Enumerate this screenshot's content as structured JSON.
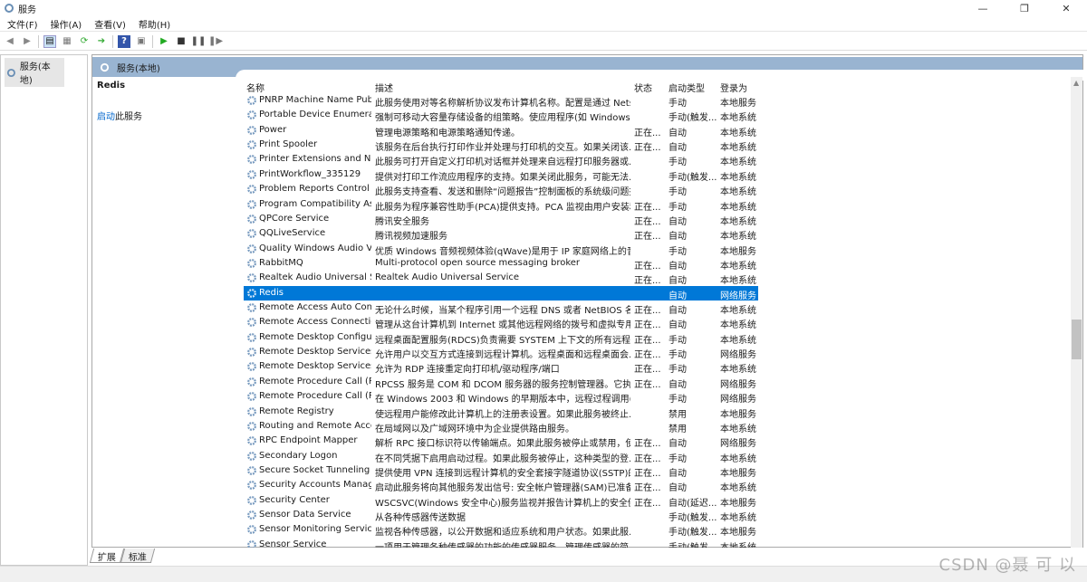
{
  "window": {
    "title": "服务",
    "minimize": "—",
    "maximize": "❐",
    "close": "✕"
  },
  "menu": [
    "文件(F)",
    "操作(A)",
    "查看(V)",
    "帮助(H)"
  ],
  "tree": {
    "root": "服务(本地)"
  },
  "pane": {
    "header": "服务(本地)",
    "selected_service": "Redis",
    "action_link": "启动",
    "action_suffix": "此服务"
  },
  "columns": [
    "名称",
    "描述",
    "状态",
    "启动类型",
    "登录为"
  ],
  "rows": [
    [
      "PNRP Machine Name Publ...",
      "此服务使用对等名称解析协议发布计算机名称。配置是通过 Nets...",
      "",
      "手动",
      "本地服务"
    ],
    [
      "Portable Device Enumerat...",
      "强制可移动大容量存储设备的组策略。使应用程序(如 Windows ...",
      "",
      "手动(触发...",
      "本地系统"
    ],
    [
      "Power",
      "管理电源策略和电源策略通知传递。",
      "正在...",
      "自动",
      "本地系统"
    ],
    [
      "Print Spooler",
      "该服务在后台执行打印作业并处理与打印机的交互。如果关闭该...",
      "正在...",
      "自动",
      "本地系统"
    ],
    [
      "Printer Extensions and Noti...",
      "此服务可打开自定义打印机对话框并处理来自远程打印服务器或...",
      "",
      "手动",
      "本地系统"
    ],
    [
      "PrintWorkflow_335129",
      "提供对打印工作流应用程序的支持。如果关闭此服务，可能无法...",
      "",
      "手动(触发...",
      "本地系统"
    ],
    [
      "Problem Reports Control P...",
      "此服务支持查看、发送和删除“问题报告”控制面板的系统级问题报...",
      "",
      "手动",
      "本地系统"
    ],
    [
      "Program Compatibility Assi...",
      "此服务为程序兼容性助手(PCA)提供支持。PCA 监视由用户安装和...",
      "正在...",
      "手动",
      "本地系统"
    ],
    [
      "QPCore Service",
      "腾讯安全服务",
      "正在...",
      "自动",
      "本地系统"
    ],
    [
      "QQLiveService",
      "腾讯视频加速服务",
      "正在...",
      "自动",
      "本地系统"
    ],
    [
      "Quality Windows Audio Vi...",
      "优质 Windows 音频视频体验(qWave)是用于 IP 家庭网络上的音...",
      "",
      "手动",
      "本地服务"
    ],
    [
      "RabbitMQ",
      "Multi-protocol open source messaging broker",
      "正在...",
      "自动",
      "本地系统"
    ],
    [
      "Realtek Audio Universal Se...",
      "Realtek Audio Universal Service",
      "正在...",
      "自动",
      "本地系统"
    ],
    [
      "Redis",
      "",
      "",
      "自动",
      "网络服务"
    ],
    [
      "Remote Access Auto Conn...",
      "无论什么时候，当某个程序引用一个远程 DNS 或者 NetBIOS 名...",
      "正在...",
      "自动",
      "本地系统"
    ],
    [
      "Remote Access Connectio...",
      "管理从这台计算机到 Internet 或其他远程网络的拨号和虚拟专用...",
      "正在...",
      "自动",
      "本地系统"
    ],
    [
      "Remote Desktop Configur...",
      "远程桌面配置服务(RDCS)负责需要 SYSTEM 上下文的所有远程桌...",
      "正在...",
      "手动",
      "本地系统"
    ],
    [
      "Remote Desktop Services",
      "允许用户以交互方式连接到远程计算机。远程桌面和远程桌面会...",
      "正在...",
      "手动",
      "网络服务"
    ],
    [
      "Remote Desktop Services ...",
      "允许为 RDP 连接重定向打印机/驱动程序/端口",
      "正在...",
      "手动",
      "本地系统"
    ],
    [
      "Remote Procedure Call (R...",
      "RPCSS 服务是 COM 和 DCOM 服务器的服务控制管理器。它执...",
      "正在...",
      "自动",
      "网络服务"
    ],
    [
      "Remote Procedure Call (R...",
      "在 Windows 2003 和 Windows 的早期版本中，远程过程调用(RP...",
      "",
      "手动",
      "网络服务"
    ],
    [
      "Remote Registry",
      "使远程用户能修改此计算机上的注册表设置。如果此服务被终止...",
      "",
      "禁用",
      "本地服务"
    ],
    [
      "Routing and Remote Access",
      "在局域网以及广域网环境中为企业提供路由服务。",
      "",
      "禁用",
      "本地系统"
    ],
    [
      "RPC Endpoint Mapper",
      "解析 RPC 接口标识符以传输端点。如果此服务被停止或禁用，使...",
      "正在...",
      "自动",
      "网络服务"
    ],
    [
      "Secondary Logon",
      "在不同凭据下启用启动过程。如果此服务被停止，这种类型的登...",
      "正在...",
      "手动",
      "本地系统"
    ],
    [
      "Secure Socket Tunneling P...",
      "提供使用 VPN 连接到远程计算机的安全套接字隧道协议(SSTP)的...",
      "正在...",
      "自动",
      "本地服务"
    ],
    [
      "Security Accounts Manager",
      "启动此服务将向其他服务发出信号: 安全帐户管理器(SAM)已准备...",
      "正在...",
      "自动",
      "本地系统"
    ],
    [
      "Security Center",
      "WSCSVC(Windows 安全中心)服务监视并报告计算机上的安全健...",
      "正在...",
      "自动(延迟...",
      "本地服务"
    ],
    [
      "Sensor Data Service",
      "从各种传感器传送数据",
      "",
      "手动(触发...",
      "本地系统"
    ],
    [
      "Sensor Monitoring Service",
      "监视各种传感器，以公开数据和适应系统和用户状态。如果此服...",
      "",
      "手动(触发...",
      "本地服务"
    ],
    [
      "Sensor Service",
      "一项用于管理各种传感器的功能的传感器服务。管理传感器的简...",
      "",
      "手动(触发...",
      "本地系统"
    ]
  ],
  "selected_index": 13,
  "tabs": [
    "扩展",
    "标准"
  ],
  "watermark": "CSDN @聂 可 以",
  "colors": {
    "selection": "#0078d7",
    "header": "#99b4d1"
  }
}
